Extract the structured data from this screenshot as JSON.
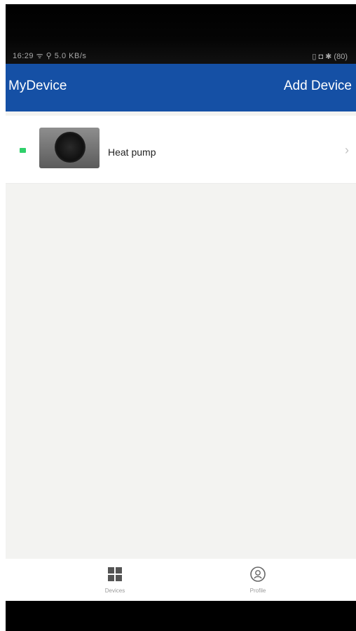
{
  "status_bar": {
    "left_text": "16:29 ᯤ ⚲ 5.0 KB/s",
    "right_text": "▯ ◘ ✱ (80)"
  },
  "app_bar": {
    "title": "MyDevice",
    "action_label": "Add Device"
  },
  "devices": [
    {
      "name": "Heat pump",
      "status": "online",
      "status_color": "#2fd06a",
      "thumbnail": "heat-pump-unit-image"
    }
  ],
  "tabs": [
    {
      "label": "Devices",
      "icon": "grid-icon"
    },
    {
      "label": "Profile",
      "icon": "profile-icon"
    }
  ],
  "colors": {
    "app_bar": "#1550a5",
    "background": "#f3f3f1"
  }
}
